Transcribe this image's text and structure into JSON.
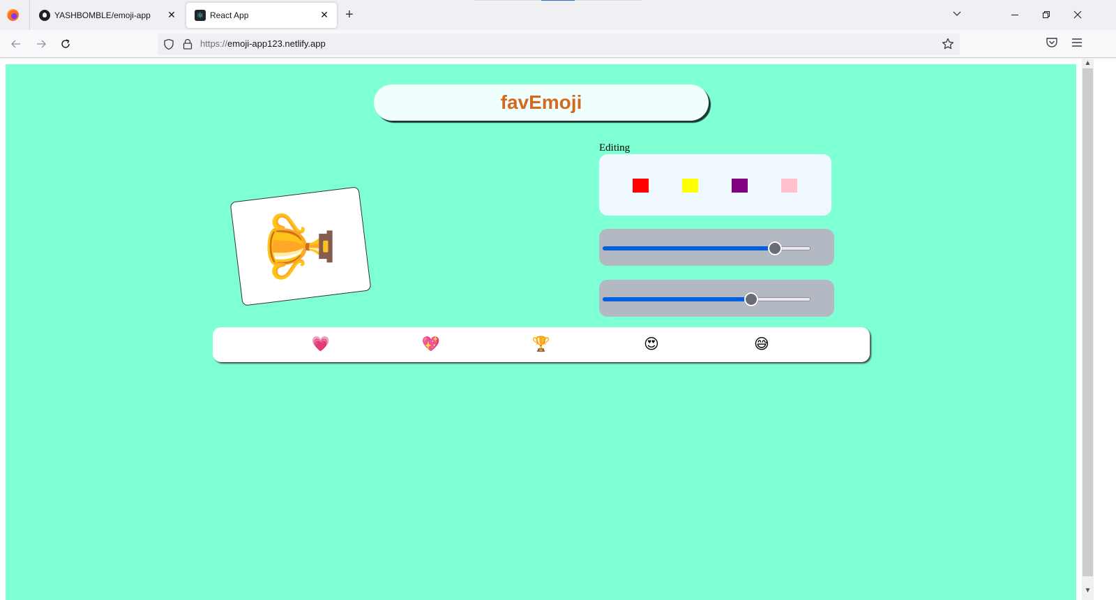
{
  "browser": {
    "tabs": [
      {
        "title": "YASHBOMBLE/emoji-app",
        "icon": "github-icon",
        "active": false
      },
      {
        "title": "React App",
        "icon": "react-icon",
        "active": true
      }
    ],
    "url_scheme": "https://",
    "url_host": "emoji-app123.netlify.app"
  },
  "app": {
    "title": "favEmoji",
    "editing_label": "Editing",
    "selected_emoji": "🏆",
    "colors": [
      {
        "name": "red",
        "hex": "#ff0000"
      },
      {
        "name": "yellow",
        "hex": "#ffff00"
      },
      {
        "name": "purple",
        "hex": "#800080"
      },
      {
        "name": "pink",
        "hex": "#ffc0cb"
      }
    ],
    "sliders": [
      {
        "name": "slider-1",
        "value_fraction": 0.83
      },
      {
        "name": "slider-2",
        "value_fraction": 0.715
      }
    ],
    "emojis": [
      {
        "char": "💗",
        "name": "heart"
      },
      {
        "char": "💖",
        "name": "sparkling-heart"
      },
      {
        "char": "🏆",
        "name": "trophy"
      },
      {
        "char": "😍",
        "name": "heart-eyes"
      },
      {
        "char": "😅",
        "name": "grinning-sweat"
      }
    ],
    "accent_colors": {
      "background": "#7fffd4",
      "title_text": "#d2691e",
      "title_bg": "#f0fffe",
      "color_panel_bg": "#f0f8ff",
      "slider_panel_bg": "#b3b9c2",
      "slider_fill": "#0060df"
    }
  }
}
